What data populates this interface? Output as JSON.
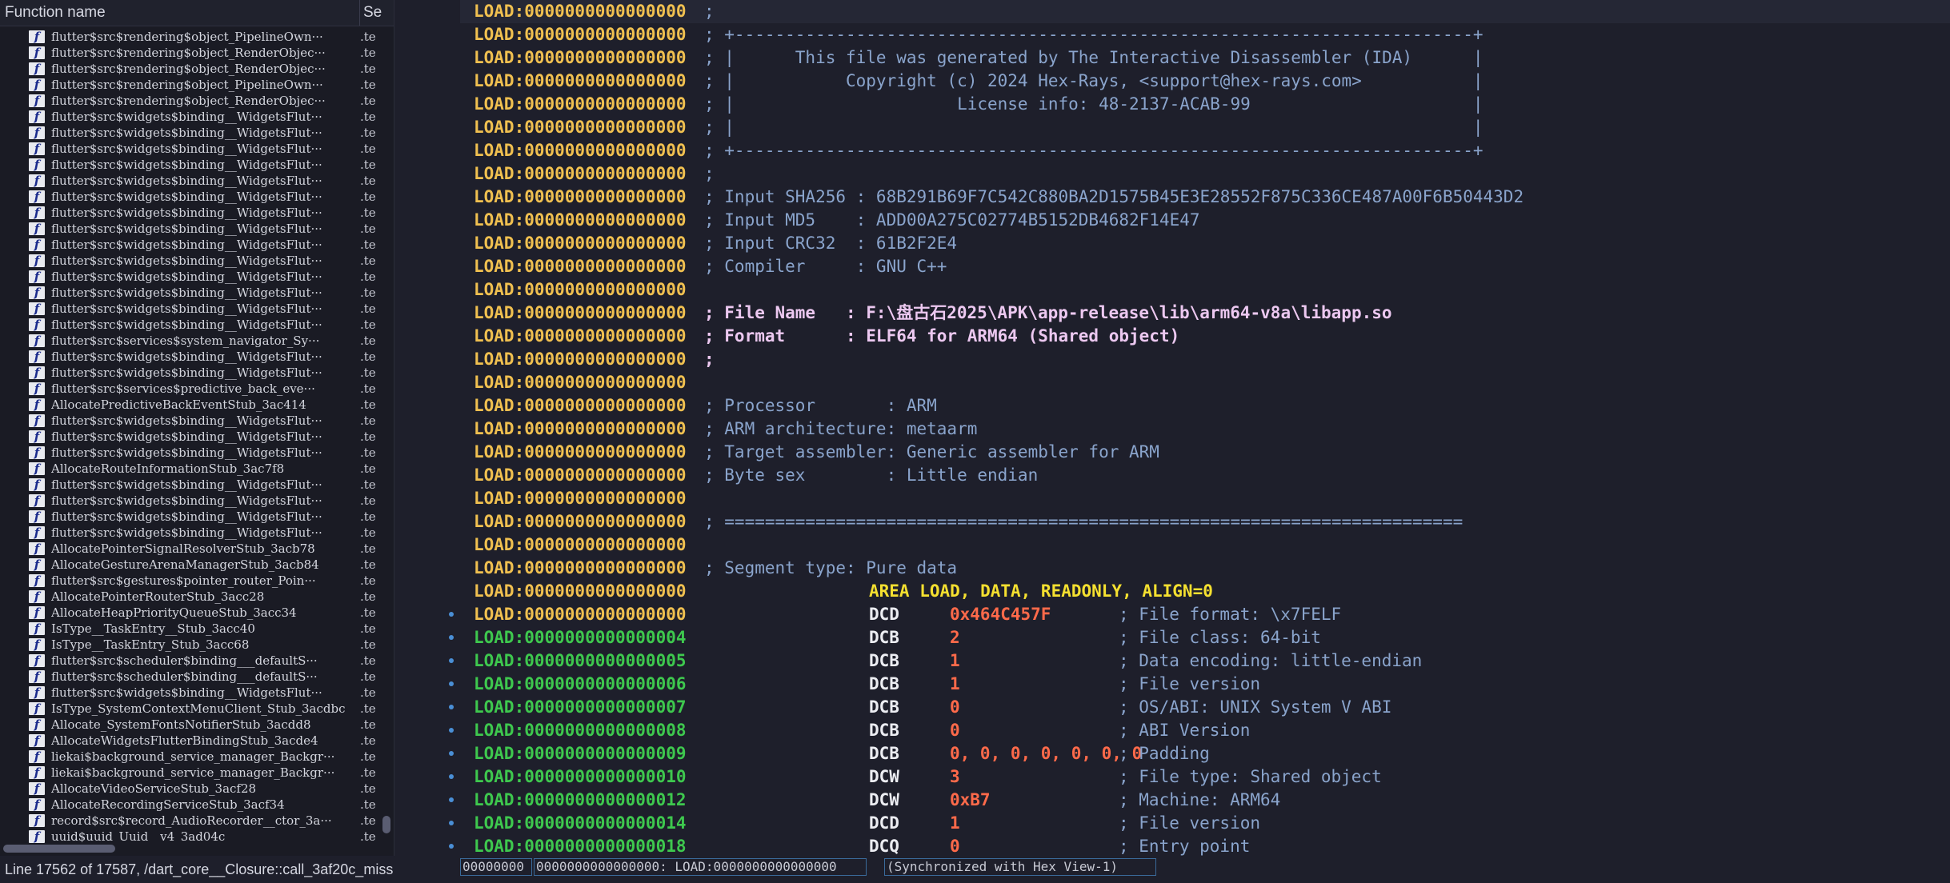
{
  "function_panel": {
    "header": {
      "name": "Function name",
      "segment": "Se"
    },
    "icon_letter": "f",
    "rows": [
      {
        "name": "flutter$src$rendering$object_PipelineOwn···",
        "seg": ".te"
      },
      {
        "name": "flutter$src$rendering$object_RenderObjec···",
        "seg": ".te"
      },
      {
        "name": "flutter$src$rendering$object_RenderObjec···",
        "seg": ".te"
      },
      {
        "name": "flutter$src$rendering$object_PipelineOwn···",
        "seg": ".te"
      },
      {
        "name": "flutter$src$rendering$object_RenderObjec···",
        "seg": ".te"
      },
      {
        "name": "flutter$src$widgets$binding__WidgetsFlut···",
        "seg": ".te"
      },
      {
        "name": "flutter$src$widgets$binding__WidgetsFlut···",
        "seg": ".te"
      },
      {
        "name": "flutter$src$widgets$binding__WidgetsFlut···",
        "seg": ".te"
      },
      {
        "name": "flutter$src$widgets$binding__WidgetsFlut···",
        "seg": ".te"
      },
      {
        "name": "flutter$src$widgets$binding__WidgetsFlut···",
        "seg": ".te"
      },
      {
        "name": "flutter$src$widgets$binding__WidgetsFlut···",
        "seg": ".te"
      },
      {
        "name": "flutter$src$widgets$binding__WidgetsFlut···",
        "seg": ".te"
      },
      {
        "name": "flutter$src$widgets$binding__WidgetsFlut···",
        "seg": ".te"
      },
      {
        "name": "flutter$src$widgets$binding__WidgetsFlut···",
        "seg": ".te"
      },
      {
        "name": "flutter$src$widgets$binding__WidgetsFlut···",
        "seg": ".te"
      },
      {
        "name": "flutter$src$widgets$binding__WidgetsFlut···",
        "seg": ".te"
      },
      {
        "name": "flutter$src$widgets$binding__WidgetsFlut···",
        "seg": ".te"
      },
      {
        "name": "flutter$src$widgets$binding__WidgetsFlut···",
        "seg": ".te"
      },
      {
        "name": "flutter$src$widgets$binding__WidgetsFlut···",
        "seg": ".te"
      },
      {
        "name": "flutter$src$services$system_navigator_Sy···",
        "seg": ".te"
      },
      {
        "name": "flutter$src$widgets$binding__WidgetsFlut···",
        "seg": ".te"
      },
      {
        "name": "flutter$src$widgets$binding__WidgetsFlut···",
        "seg": ".te"
      },
      {
        "name": "flutter$src$services$predictive_back_eve···",
        "seg": ".te"
      },
      {
        "name": "AllocatePredictiveBackEventStub_3ac414",
        "seg": ".te"
      },
      {
        "name": "flutter$src$widgets$binding__WidgetsFlut···",
        "seg": ".te"
      },
      {
        "name": "flutter$src$widgets$binding__WidgetsFlut···",
        "seg": ".te"
      },
      {
        "name": "flutter$src$widgets$binding__WidgetsFlut···",
        "seg": ".te"
      },
      {
        "name": "AllocateRouteInformationStub_3ac7f8",
        "seg": ".te"
      },
      {
        "name": "flutter$src$widgets$binding__WidgetsFlut···",
        "seg": ".te"
      },
      {
        "name": "flutter$src$widgets$binding__WidgetsFlut···",
        "seg": ".te"
      },
      {
        "name": "flutter$src$widgets$binding__WidgetsFlut···",
        "seg": ".te"
      },
      {
        "name": "flutter$src$widgets$binding__WidgetsFlut···",
        "seg": ".te"
      },
      {
        "name": "AllocatePointerSignalResolverStub_3acb78",
        "seg": ".te"
      },
      {
        "name": "AllocateGestureArenaManagerStub_3acb84",
        "seg": ".te"
      },
      {
        "name": "flutter$src$gestures$pointer_router_Poin···",
        "seg": ".te"
      },
      {
        "name": "AllocatePointerRouterStub_3acc28",
        "seg": ".te"
      },
      {
        "name": "AllocateHeapPriorityQueueStub_3acc34",
        "seg": ".te"
      },
      {
        "name": "IsType__TaskEntry__Stub_3acc40",
        "seg": ".te"
      },
      {
        "name": "IsType__TaskEntry_Stub_3acc68",
        "seg": ".te"
      },
      {
        "name": "flutter$src$scheduler$binding___defaultS···",
        "seg": ".te"
      },
      {
        "name": "flutter$src$scheduler$binding___defaultS···",
        "seg": ".te"
      },
      {
        "name": "flutter$src$widgets$binding__WidgetsFlut···",
        "seg": ".te"
      },
      {
        "name": "IsType_SystemContextMenuClient_Stub_3acdbc",
        "seg": ".te"
      },
      {
        "name": "Allocate_SystemFontsNotifierStub_3acdd8",
        "seg": ".te"
      },
      {
        "name": "AllocateWidgetsFlutterBindingStub_3acde4",
        "seg": ".te"
      },
      {
        "name": "liekai$background_service_manager_Backgr···",
        "seg": ".te"
      },
      {
        "name": "liekai$background_service_manager_Backgr···",
        "seg": ".te"
      },
      {
        "name": "AllocateVideoServiceStub_3acf28",
        "seg": ".te"
      },
      {
        "name": "AllocateRecordingServiceStub_3acf34",
        "seg": ".te"
      },
      {
        "name": "record$src$record_AudioRecorder__ctor_3a···",
        "seg": ".te"
      },
      {
        "name": "uuid$uuid_Uuid__v4_3ad04c",
        "seg": ".te"
      }
    ],
    "status": "Line 17562 of 17587, /dart_core__Closure::call_3af20c_miss"
  },
  "disasm": {
    "lines": [
      {
        "addr": "LOAD:0000000000000000",
        "c": ";"
      },
      {
        "addr": "LOAD:0000000000000000",
        "c": "; +-------------------------------------------------------------------------+"
      },
      {
        "addr": "LOAD:0000000000000000",
        "c": "; |      This file was generated by The Interactive Disassembler (IDA)      |"
      },
      {
        "addr": "LOAD:0000000000000000",
        "c": "; |           Copyright (c) 2024 Hex-Rays, <support@hex-rays.com>           |"
      },
      {
        "addr": "LOAD:0000000000000000",
        "c": "; |                      License info: 48-2137-ACAB-99                      |"
      },
      {
        "addr": "LOAD:0000000000000000",
        "c": "; |                                                                         |"
      },
      {
        "addr": "LOAD:0000000000000000",
        "c": "; +-------------------------------------------------------------------------+"
      },
      {
        "addr": "LOAD:0000000000000000",
        "c": ";"
      },
      {
        "addr": "LOAD:0000000000000000",
        "c": "; Input SHA256 : 68B291B69F7C542C880BA2D1575B45E3E28552F875C336CE487A00F6B50443D2"
      },
      {
        "addr": "LOAD:0000000000000000",
        "c": "; Input MD5    : ADD00A275C02774B5152DB4682F14E47"
      },
      {
        "addr": "LOAD:0000000000000000",
        "c": "; Input CRC32  : 61B2F2E4"
      },
      {
        "addr": "LOAD:0000000000000000",
        "c": "; Compiler     : GNU C++"
      },
      {
        "addr": "LOAD:0000000000000000",
        "c": ""
      },
      {
        "addr": "LOAD:0000000000000000",
        "c": "; File Name   : F:\\盘古石2025\\APK\\app-release\\lib\\arm64-v8a\\libapp.so",
        "hl": true
      },
      {
        "addr": "LOAD:0000000000000000",
        "c": "; Format      : ELF64 for ARM64 (Shared object)",
        "hl": true
      },
      {
        "addr": "LOAD:0000000000000000",
        "c": ";",
        "hl": true
      },
      {
        "addr": "LOAD:0000000000000000",
        "c": ""
      },
      {
        "addr": "LOAD:0000000000000000",
        "c": "; Processor       : ARM"
      },
      {
        "addr": "LOAD:0000000000000000",
        "c": "; ARM architecture: metaarm"
      },
      {
        "addr": "LOAD:0000000000000000",
        "c": "; Target assembler: Generic assembler for ARM"
      },
      {
        "addr": "LOAD:0000000000000000",
        "c": "; Byte sex        : Little endian"
      },
      {
        "addr": "LOAD:0000000000000000",
        "c": ""
      },
      {
        "addr": "LOAD:0000000000000000",
        "c": "; ========================================================================="
      },
      {
        "addr": "LOAD:0000000000000000",
        "c": ""
      },
      {
        "addr": "LOAD:0000000000000000",
        "c": "; Segment type: Pure data"
      },
      {
        "addr": "LOAD:0000000000000000",
        "area": "AREA LOAD, DATA, READONLY, ALIGN=0"
      },
      {
        "addr": "LOAD:0000000000000000",
        "mn": "DCD",
        "op": "0x464C457F",
        "ec": "; File format: \\x7FELF"
      },
      {
        "addr": "LOAD:0000000000000004",
        "g": true,
        "mn": "DCB",
        "op": "2",
        "ec": "; File class: 64-bit"
      },
      {
        "addr": "LOAD:0000000000000005",
        "g": true,
        "mn": "DCB",
        "op": "1",
        "ec": "; Data encoding: little-endian"
      },
      {
        "addr": "LOAD:0000000000000006",
        "g": true,
        "mn": "DCB",
        "op": "1",
        "ec": "; File version"
      },
      {
        "addr": "LOAD:0000000000000007",
        "g": true,
        "mn": "DCB",
        "op": "0",
        "ec": "; OS/ABI: UNIX System V ABI"
      },
      {
        "addr": "LOAD:0000000000000008",
        "g": true,
        "mn": "DCB",
        "op": "0",
        "ec": "; ABI Version"
      },
      {
        "addr": "LOAD:0000000000000009",
        "g": true,
        "mn": "DCB",
        "op": "0, 0, 0, 0, 0, 0, 0",
        "ec": "; Padding"
      },
      {
        "addr": "LOAD:0000000000000010",
        "g": true,
        "mn": "DCW",
        "op": "3",
        "ec": "; File type: Shared object"
      },
      {
        "addr": "LOAD:0000000000000012",
        "g": true,
        "mn": "DCW",
        "op": "0xB7",
        "ec": "; Machine: ARM64"
      },
      {
        "addr": "LOAD:0000000000000014",
        "g": true,
        "mn": "DCD",
        "op": "1",
        "ec": "; File version"
      },
      {
        "addr": "LOAD:0000000000000018",
        "g": true,
        "mn": "DCQ",
        "op": "0",
        "ec": "; Entry point"
      }
    ],
    "status": {
      "offset": "00000000",
      "location": "0000000000000000: LOAD:0000000000000000",
      "sync": "(Synchronized with Hex View-1)"
    }
  },
  "colors": {
    "address": "#f0c050",
    "address_code": "#3ec84e",
    "comment": "#8aa4cc",
    "operand": "#ff6a4a",
    "directive": "#f5e030"
  }
}
